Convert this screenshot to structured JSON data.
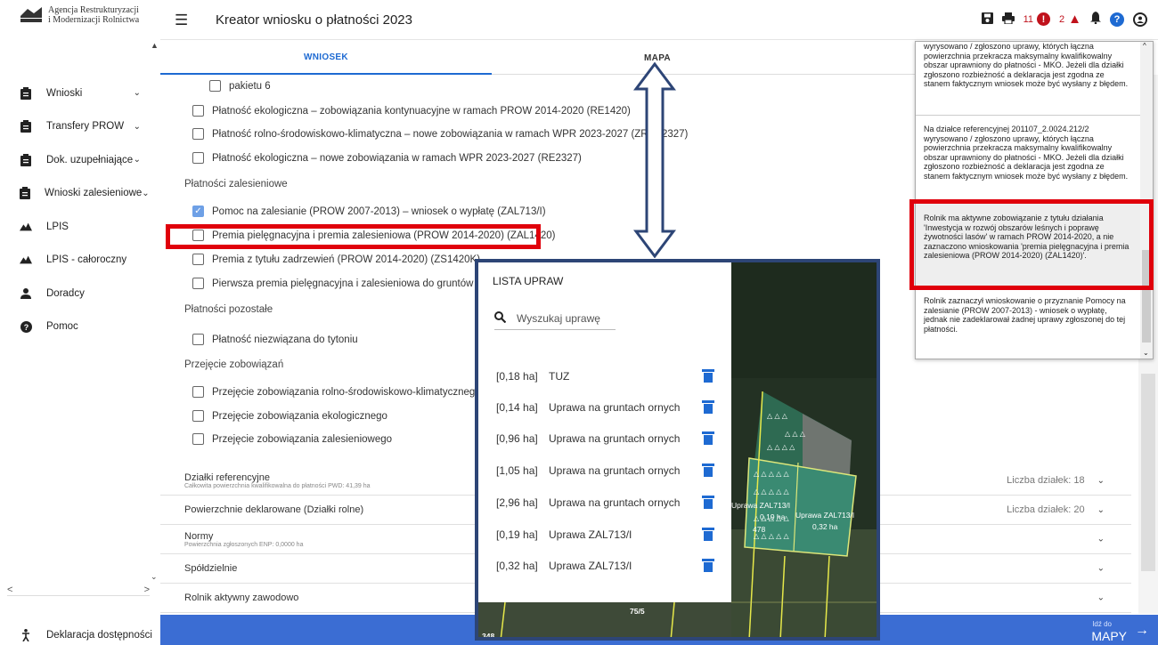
{
  "sidebar": {
    "logo_line1": "Agencja Restrukturyzacji",
    "logo_line2": "i Modernizacji Rolnictwa",
    "items": [
      {
        "label": "Wnioski",
        "icon": "clipboard-icon",
        "chevron": true
      },
      {
        "label": "Transfery PROW",
        "icon": "clipboard-icon",
        "chevron": true
      },
      {
        "label": "Dok. uzupełniające",
        "icon": "clipboard-icon",
        "chevron": true
      },
      {
        "label": "Wnioski zalesieniowe",
        "icon": "clipboard-icon",
        "chevron": true
      },
      {
        "label": "LPIS",
        "icon": "terrain-icon",
        "chevron": false
      },
      {
        "label": "LPIS - całoroczny",
        "icon": "terrain-icon",
        "chevron": false
      },
      {
        "label": "Doradcy",
        "icon": "person-icon",
        "chevron": false
      },
      {
        "label": "Pomoc",
        "icon": "help-icon",
        "chevron": false
      }
    ],
    "accessibility": "Deklaracja dostępności"
  },
  "topbar": {
    "title": "Kreator wniosku o płatności 2023",
    "error_count": "11",
    "warning_count": "2"
  },
  "tabs": {
    "wniosek": "WNIOSEK",
    "mapa": "MAPA"
  },
  "form": {
    "pakiet6": "pakietu 6",
    "re1420": "Płatność ekologiczna – zobowiązania kontynuacyjne w ramach PROW 2014-2020 (RE1420)",
    "zrsk": "Płatność rolno-środowiskowo-klimatyczna – nowe zobowiązania w ramach WPR 2023-2027 (ZRSK2327)",
    "re2327": "Płatność ekologiczna – nowe zobowiązania w ramach WPR 2023-2027 (RE2327)",
    "section_zalesieniowe": "Płatności zalesieniowe",
    "zal713": "Pomoc na zalesianie (PROW 2007-2013) – wniosek o wypłatę (ZAL713/I)",
    "zal1420": "Premia pielęgnacyjna i premia zalesieniowa (PROW 2014-2020) (ZAL1420)",
    "zs1420k": "Premia z tytułu zadrzewień (PROW 2014-2020) (ZS1420K)",
    "pierwsza": "Pierwsza premia pielęgnacyjna i zalesieniowa do gruntów z sul",
    "section_pozostale": "Płatności pozostałe",
    "tyton": "Płatność niezwiązana do tytoniu",
    "section_przejecie": "Przejęcie zobowiązań",
    "przejecie_rsk": "Przejęcie zobowiązania rolno-środowiskowo-klimatycznego",
    "przejecie_eko": "Przejęcie zobowiązania ekologicznego",
    "przejecie_zal": "Przejęcie zobowiązania zalesieniowego"
  },
  "accordions": [
    {
      "title": "Działki referencyjne",
      "subtitle": "Całkowita powierzchnia kwalifikowalna do płatności PWD: 41,39 ha",
      "right": "Liczba działek: 18"
    },
    {
      "title": "Powierzchnie deklarowane (Działki rolne)",
      "subtitle": "",
      "right": "Liczba działek: 20"
    },
    {
      "title": "Normy",
      "subtitle": "Powierzchnia zgłoszonych ENP: 0,0000 ha",
      "right": ""
    },
    {
      "title": "Spółdzielnie",
      "subtitle": "",
      "right": ""
    },
    {
      "title": "Rolnik aktywny zawodowo",
      "subtitle": "",
      "right": ""
    }
  ],
  "bottombar": {
    "small": "Idź do",
    "big": "MAPY"
  },
  "notifications": {
    "msg1": "wyrysowano / zgłoszono uprawy, których łączna powierzchnia przekracza maksymalny kwalifikowalny obszar uprawniony do płatności - MKO. Jeżeli dla działki zgłoszono rozbieżność a deklaracja jest zgodna ze stanem faktycznym wniosek może być wysłany z błędem.",
    "msg2": "Na działce referencyjnej 201107_2.0024.212/2 wyrysowano / zgłoszono uprawy, których łączna powierzchnia przekracza maksymalny kwalifikowalny obszar uprawniony do płatności - MKO. Jeżeli dla działki zgłoszono rozbieżność a deklaracja jest zgodna ze stanem faktycznym wniosek może być wysłany z błędem.",
    "msg3": "Rolnik ma aktywne zobowiązanie z tytułu działania 'Inwestycja w rozwój obszarów leśnych i poprawę żywotności lasów' w ramach PROW 2014-2020, a nie zaznaczono wnioskowania 'premia pielęgnacyjna i premia zalesieniowa (PROW 2014-2020) (ZAL1420)'.",
    "msg4": "Rolnik zaznaczył wnioskowanie o przyznanie Pomocy na zalesianie (PROW 2007-2013) - wniosek o wypłatę, jednak nie zadeklarował żadnej uprawy zgłoszonej do tej płatności."
  },
  "crop_panel": {
    "title": "LISTA UPRAW",
    "search_placeholder": "Wyszukaj uprawę",
    "crops": [
      {
        "area": "[0,18 ha]",
        "name": "TUZ"
      },
      {
        "area": "[0,14 ha]",
        "name": "Uprawa na gruntach ornych"
      },
      {
        "area": "[0,96 ha]",
        "name": "Uprawa na gruntach ornych"
      },
      {
        "area": "[1,05 ha]",
        "name": "Uprawa na gruntach ornych"
      },
      {
        "area": "[2,96 ha]",
        "name": "Uprawa na gruntach ornych"
      },
      {
        "area": "[0,19 ha]",
        "name": "Uprawa ZAL713/I"
      },
      {
        "area": "[0,32 ha]",
        "name": "Uprawa ZAL713/I"
      }
    ],
    "map_labels": {
      "l1": "Uprawa ZAL713/I",
      "l2": "0,19 ha",
      "l3": "Uprawa ZAL713/I",
      "l4": "0,32 ha",
      "l5": "478",
      "l6": "75/5",
      "l7": "348"
    }
  }
}
